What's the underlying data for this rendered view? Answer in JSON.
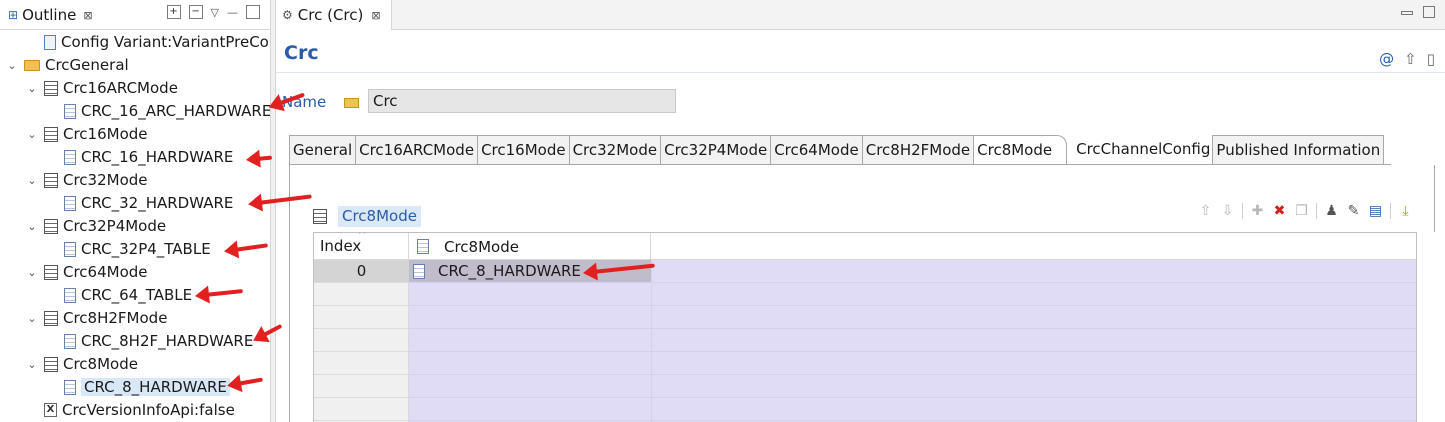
{
  "outline": {
    "tab_title": "Outline",
    "close_glyph": "⊠",
    "tree": [
      {
        "label": "Config Variant:VariantPreComp",
        "icon": "config-file-icon",
        "level": 1,
        "twisty": ""
      },
      {
        "label": "CrcGeneral",
        "icon": "folder-icon",
        "level": 0,
        "twisty": "⌄"
      },
      {
        "label": "Crc16ARCMode",
        "icon": "table-icon",
        "level": 1,
        "twisty": "⌄"
      },
      {
        "label": "CRC_16_ARC_HARDWARE",
        "icon": "document-icon",
        "level": 2,
        "twisty": ""
      },
      {
        "label": "Crc16Mode",
        "icon": "table-icon",
        "level": 1,
        "twisty": "⌄"
      },
      {
        "label": "CRC_16_HARDWARE",
        "icon": "document-icon",
        "level": 2,
        "twisty": ""
      },
      {
        "label": "Crc32Mode",
        "icon": "table-icon",
        "level": 1,
        "twisty": "⌄"
      },
      {
        "label": "CRC_32_HARDWARE",
        "icon": "document-icon",
        "level": 2,
        "twisty": ""
      },
      {
        "label": "Crc32P4Mode",
        "icon": "table-icon",
        "level": 1,
        "twisty": "⌄"
      },
      {
        "label": "CRC_32P4_TABLE",
        "icon": "document-icon",
        "level": 2,
        "twisty": ""
      },
      {
        "label": "Crc64Mode",
        "icon": "table-icon",
        "level": 1,
        "twisty": "⌄"
      },
      {
        "label": "CRC_64_TABLE",
        "icon": "document-icon",
        "level": 2,
        "twisty": ""
      },
      {
        "label": "Crc8H2FMode",
        "icon": "table-icon",
        "level": 1,
        "twisty": "⌄"
      },
      {
        "label": "CRC_8H2F_HARDWARE",
        "icon": "document-icon",
        "level": 2,
        "twisty": ""
      },
      {
        "label": "Crc8Mode",
        "icon": "table-icon",
        "level": 1,
        "twisty": "⌄"
      },
      {
        "label": "CRC_8_HARDWARE",
        "icon": "document-icon",
        "level": 2,
        "twisty": "",
        "selected": true
      },
      {
        "label": "CrcVersionInfoApi:false",
        "icon": "boolean-x-icon",
        "level": 1,
        "twisty": ""
      }
    ]
  },
  "editor": {
    "tab_title": "Crc (Crc)",
    "close_glyph": "⊠",
    "form_title": "Crc",
    "name_label": "Name",
    "name_value": "Crc",
    "page_tabs": [
      "General",
      "Crc16ARCMode",
      "Crc16Mode",
      "Crc32Mode",
      "Crc32P4Mode",
      "Crc64Mode",
      "Crc8H2FMode",
      "Crc8Mode",
      "CrcChannelConfig",
      "Published Information"
    ],
    "active_page_tab": "Crc8Mode",
    "section_title": "Crc8Mode",
    "table": {
      "columns": [
        "Index",
        "Crc8Mode"
      ],
      "rows": [
        {
          "index": "0",
          "value": "CRC_8_HARDWARE"
        }
      ]
    }
  },
  "colors": {
    "accent_blue": "#2a5caa",
    "annotation_red": "#e32020",
    "table_fill": "#e1dcf5"
  }
}
